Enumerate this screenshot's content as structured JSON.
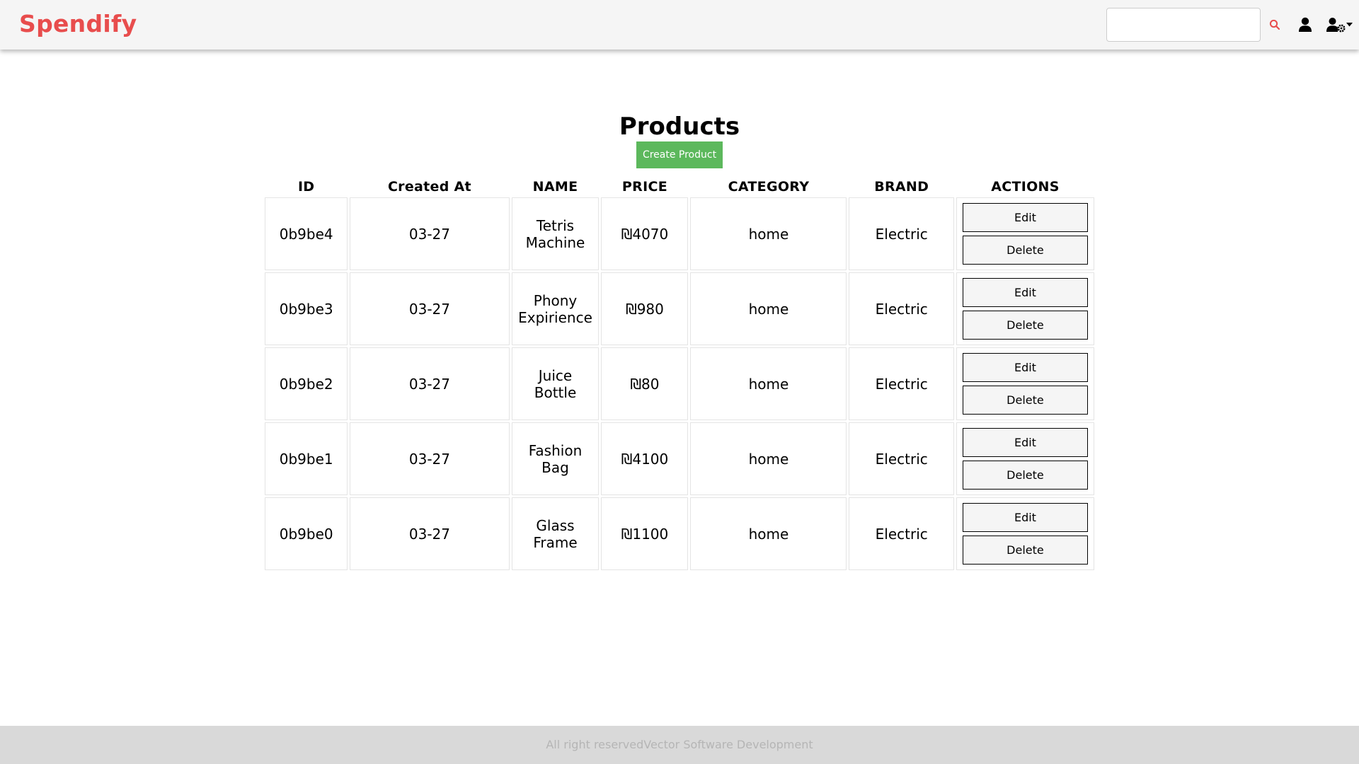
{
  "app": {
    "brand": "Spendify",
    "accent_color": "#e84d4d"
  },
  "header": {
    "search": {
      "value": "",
      "placeholder": ""
    },
    "icons": [
      "search-icon",
      "user-icon",
      "user-settings-icon",
      "caret-down-icon"
    ]
  },
  "main": {
    "title": "Products",
    "create_label": "Create Product",
    "create_color": "#5cb85c"
  },
  "table": {
    "headers": [
      "ID",
      "Created At",
      "NAME",
      "PRICE",
      "CATEGORY",
      "BRAND",
      "ACTIONS"
    ],
    "edit_label": "Edit",
    "delete_label": "Delete",
    "rows": [
      {
        "id": "0b9be4",
        "created_at": "03-27",
        "name": "Tetris Machine",
        "price": "₪4070",
        "category": "home",
        "brand": "Electric"
      },
      {
        "id": "0b9be3",
        "created_at": "03-27",
        "name": "Phony Expirience",
        "price": "₪980",
        "category": "home",
        "brand": "Electric"
      },
      {
        "id": "0b9be2",
        "created_at": "03-27",
        "name": "Juice Bottle",
        "price": "₪80",
        "category": "home",
        "brand": "Electric"
      },
      {
        "id": "0b9be1",
        "created_at": "03-27",
        "name": "Fashion Bag",
        "price": "₪4100",
        "category": "home",
        "brand": "Electric"
      },
      {
        "id": "0b9be0",
        "created_at": "03-27",
        "name": "Glass Frame",
        "price": "₪1100",
        "category": "home",
        "brand": "Electric"
      }
    ]
  },
  "footer": {
    "text": "All right reservedVector Software Development"
  }
}
